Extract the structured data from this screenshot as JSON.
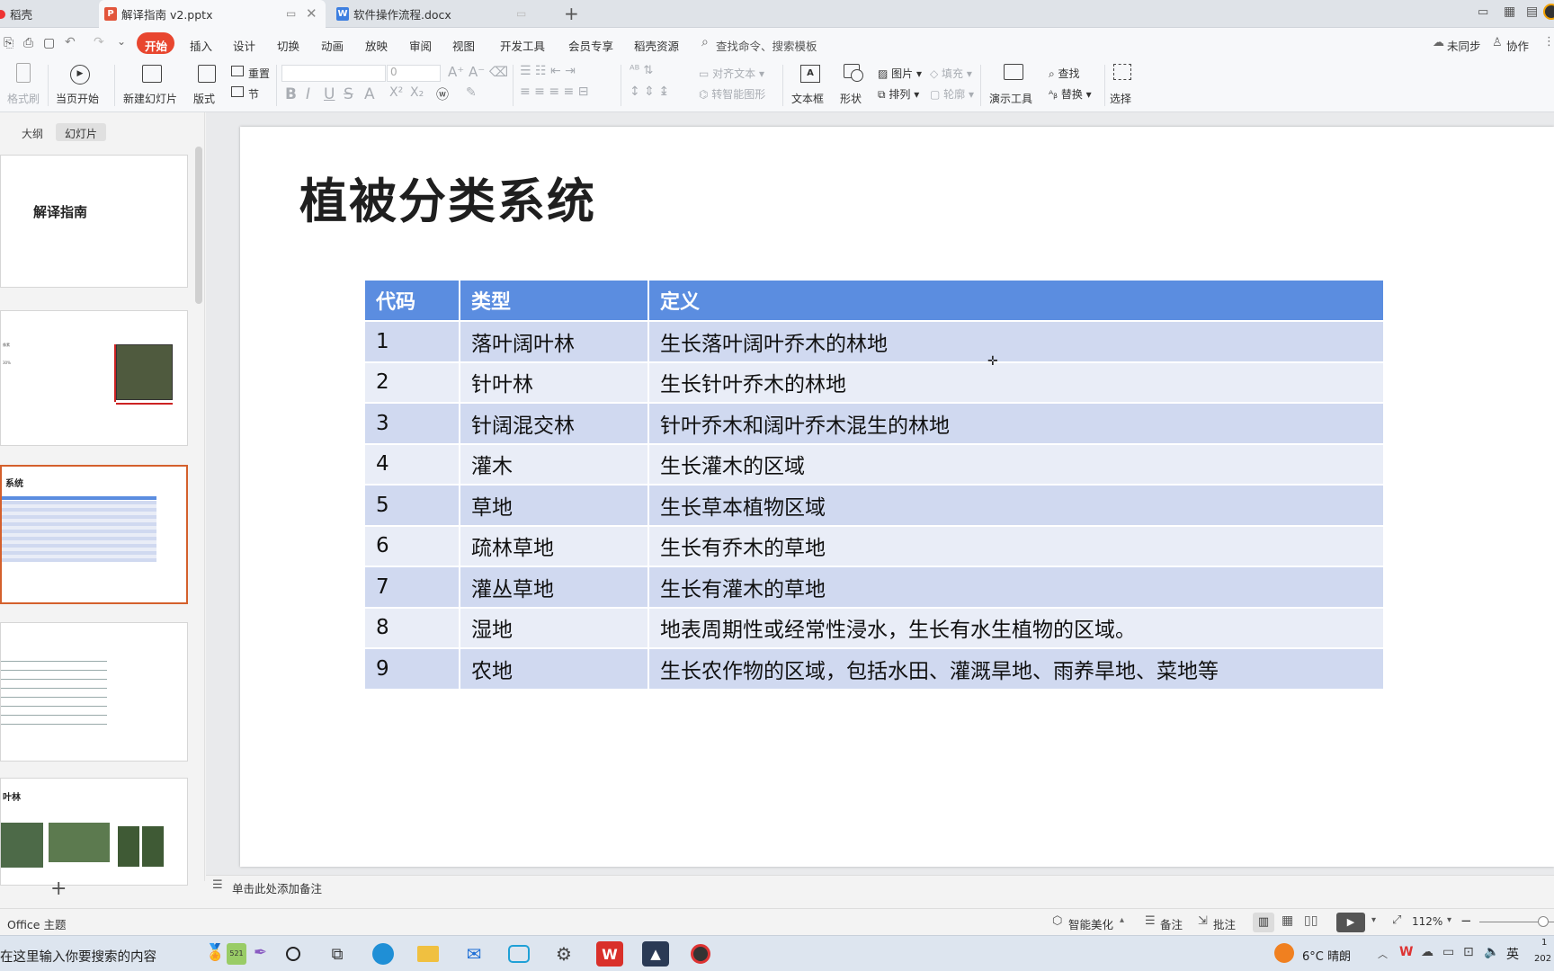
{
  "tabs": [
    {
      "label": "稻壳"
    },
    {
      "label": "解译指南 v2.pptx"
    },
    {
      "label": "软件操作流程.docx"
    }
  ],
  "menu": [
    "开始",
    "插入",
    "设计",
    "切换",
    "动画",
    "放映",
    "审阅",
    "视图",
    "开发工具",
    "会员专享",
    "稻壳资源"
  ],
  "search_placeholder": "查找命令、搜索模板",
  "menu_right": {
    "sync": "未同步",
    "collab": "协作"
  },
  "ribbon": {
    "format_painter": "格式刷",
    "from_current": "当页开始",
    "new_slide": "新建幻灯片",
    "layout": "版式",
    "reset": "重置",
    "section": "节",
    "font_size": "0",
    "align_text": "对齐文本",
    "smartart": "转智能图形",
    "textbox": "文本框",
    "shape": "形状",
    "picture": "图片",
    "arrange": "排列",
    "fill": "填充",
    "outline": "轮廓",
    "present_tools": "演示工具",
    "find": "查找",
    "replace": "替换",
    "select": "选择"
  },
  "panel": {
    "outline_tab": "大纲",
    "slides_tab": "幻灯片",
    "slide1_title": "解译指南",
    "slide3_title": "系统",
    "slide5_title": "叶林",
    "slide2_pct": "30%"
  },
  "slide": {
    "title": "植被分类系统",
    "headers": [
      "代码",
      "类型",
      "定义"
    ],
    "rows": [
      [
        "1",
        "落叶阔叶林",
        "生长落叶阔叶乔木的林地"
      ],
      [
        "2",
        "针叶林",
        "生长针叶乔木的林地"
      ],
      [
        "3",
        "针阔混交林",
        "针叶乔木和阔叶乔木混生的林地"
      ],
      [
        "4",
        "灌木",
        "生长灌木的区域"
      ],
      [
        "5",
        "草地",
        "生长草本植物区域"
      ],
      [
        "6",
        "疏林草地",
        "生长有乔木的草地"
      ],
      [
        "7",
        "灌丛草地",
        "生长有灌木的草地"
      ],
      [
        "8",
        "湿地",
        "地表周期性或经常性浸水，生长有水生植物的区域。"
      ],
      [
        "9",
        "农地",
        "生长农作物的区域，包括水田、灌溉旱地、雨养旱地、菜地等"
      ]
    ]
  },
  "notes_placeholder": "单击此处添加备注",
  "status": {
    "theme": "Office 主题",
    "beautify": "智能美化",
    "notes": "备注",
    "comments": "批注",
    "zoom": "112%"
  },
  "taskbar": {
    "search": "在这里输入你要搜索的内容",
    "weather": "6°C 晴朗",
    "ime": "英",
    "clock_top": "1",
    "clock_bottom": "202"
  }
}
